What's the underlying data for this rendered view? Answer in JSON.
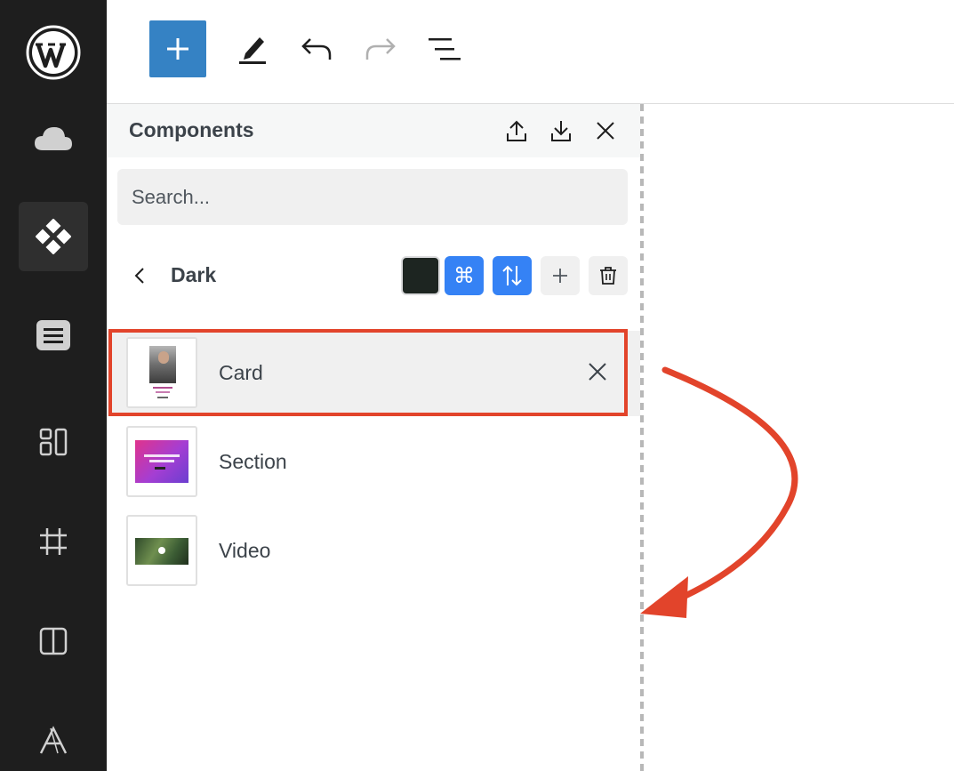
{
  "sidebar": {
    "items": [
      {
        "name": "wordpress-logo-icon"
      },
      {
        "name": "cloud-icon"
      },
      {
        "name": "components-icon",
        "active": true
      },
      {
        "name": "pages-icon"
      },
      {
        "name": "layout-icon"
      },
      {
        "name": "frame-icon"
      },
      {
        "name": "columns-icon"
      },
      {
        "name": "typography-icon"
      }
    ]
  },
  "toolbar": {
    "buttons": [
      "add-icon",
      "pen-icon",
      "undo-icon",
      "redo-icon",
      "list-view-icon"
    ]
  },
  "panel": {
    "title": "Components",
    "search_placeholder": "Search...",
    "group": {
      "name": "Dark",
      "swatch_color": "#1d2521",
      "command_glyph": "⌘"
    },
    "items": [
      {
        "label": "Card",
        "selected": true
      },
      {
        "label": "Section",
        "selected": false
      },
      {
        "label": "Video",
        "selected": false
      }
    ]
  },
  "colors": {
    "accent": "#3582c4",
    "toggle_active": "#3582f5",
    "annotation": "#e2442b",
    "sidebar_bg": "#1e1e1e"
  }
}
